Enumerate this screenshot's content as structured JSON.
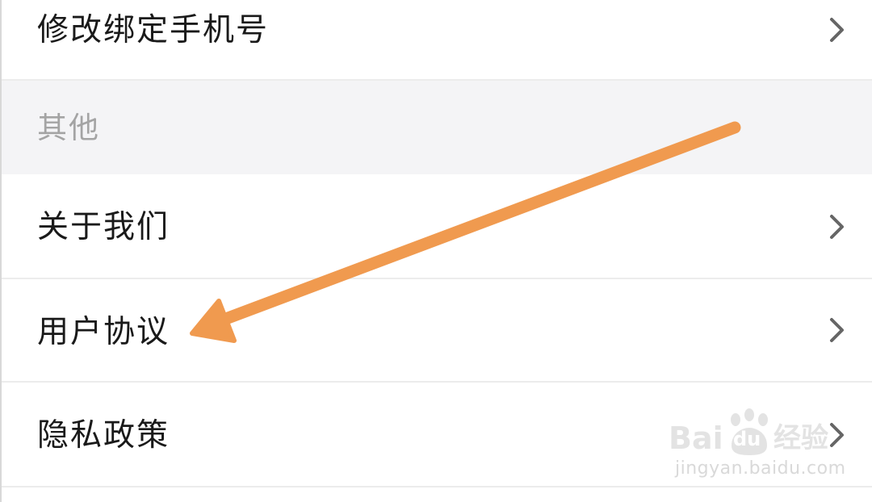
{
  "settings": {
    "items_top": [
      {
        "label": "修改绑定手机号"
      }
    ],
    "section": {
      "label": "其他"
    },
    "items": [
      {
        "label": "关于我们"
      },
      {
        "label": "用户协议"
      },
      {
        "label": "隐私政策"
      }
    ]
  },
  "annotation": {
    "arrow_color": "#f09a4f",
    "points_to": "用户协议"
  },
  "watermark": {
    "brand_left": "Bai",
    "brand_right": "经验",
    "brand_du": "du",
    "url": "jingyan.baidu.com"
  },
  "colors": {
    "section_bg": "#f4f4f6",
    "divider": "#ececec",
    "text": "#1a1a1a",
    "section_text": "#a4a4a4",
    "chevron": "#666666"
  }
}
